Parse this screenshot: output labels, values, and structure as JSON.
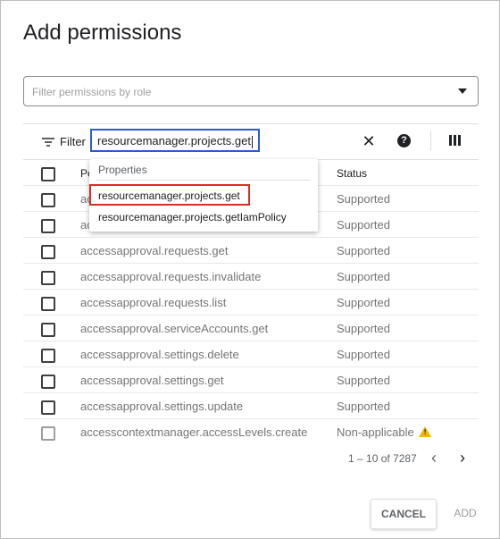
{
  "dialog": {
    "title": "Add permissions",
    "role_filter_placeholder": "Filter permissions by role"
  },
  "toolbar": {
    "filter_label": "Filter",
    "filter_value": "resourcemanager.projects.get",
    "icons": [
      "filter-icon",
      "close-icon",
      "help-icon",
      "columns-icon"
    ]
  },
  "dropdown": {
    "header": "Properties",
    "items": [
      "resourcemanager.projects.get",
      "resourcemanager.projects.getIamPolicy"
    ]
  },
  "table": {
    "headers": {
      "permission": "Pe",
      "status": "Status"
    },
    "rows": [
      {
        "permission": "ac",
        "status": "Supported"
      },
      {
        "permission": "ac",
        "status": "Supported"
      },
      {
        "permission": "accessapproval.requests.get",
        "status": "Supported"
      },
      {
        "permission": "accessapproval.requests.invalidate",
        "status": "Supported"
      },
      {
        "permission": "accessapproval.requests.list",
        "status": "Supported"
      },
      {
        "permission": "accessapproval.serviceAccounts.get",
        "status": "Supported"
      },
      {
        "permission": "accessapproval.settings.delete",
        "status": "Supported"
      },
      {
        "permission": "accessapproval.settings.get",
        "status": "Supported"
      },
      {
        "permission": "accessapproval.settings.update",
        "status": "Supported"
      },
      {
        "permission": "accesscontextmanager.accessLevels.create",
        "status": "Non-applicable"
      }
    ]
  },
  "pagination": {
    "range": "1 – 10 of 7287"
  },
  "actions": {
    "cancel": "CANCEL",
    "add": "ADD"
  },
  "colors": {
    "accent_blue": "#2c5bd0",
    "highlight_red": "#d93025",
    "warning_yellow": "#f2b600"
  }
}
